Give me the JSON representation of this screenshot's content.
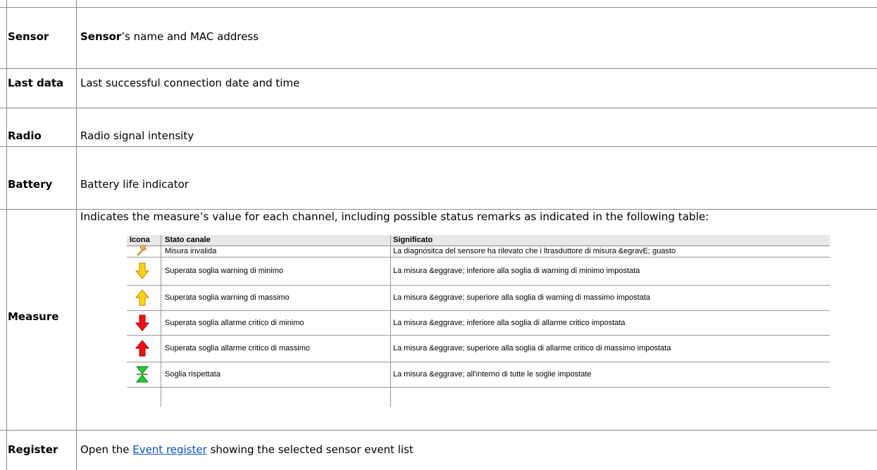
{
  "rows": [
    {
      "label": "Sensor",
      "desc_bold": "Sensor",
      "desc_rest": "’s name and MAC address"
    },
    {
      "label": "Last data",
      "desc": "Last successful connection date and time"
    },
    {
      "label": "Radio",
      "desc": "Radio signal intensity"
    },
    {
      "label": "Battery",
      "desc": "Battery life indicator"
    },
    {
      "label": "Measure",
      "desc": "Indicates the measure’s value for each channel, including possible status remarks as indicated in the following table:"
    },
    {
      "label": "Register",
      "desc_pre": "Open the ",
      "link": "Event register",
      "desc_post": " showing the selected sensor event list"
    }
  ],
  "status_table": {
    "headers": [
      "Icona",
      "Stato canale",
      "Significato"
    ],
    "rows": [
      {
        "icon": "wrench-icon",
        "state": "Misura invalida",
        "meaning": "La diagnositca del sensore ha rilevato che i ltrasduttore di misura &egravE; guasto"
      },
      {
        "icon": "arrow-down-yellow-icon",
        "state": "Superata soglia warning di minimo",
        "meaning": "La misura &eggrave; inferiore alla soglia di warning di minimo impostata"
      },
      {
        "icon": "arrow-up-yellow-icon",
        "state": "Superata soglia warning di massimo",
        "meaning": "La misura &eggrave; superiore alla soglia di warning di massimo impostata"
      },
      {
        "icon": "arrow-down-red-icon",
        "state": "Superata soglia allarme critico di minimo",
        "meaning": "La misura &eggrave; inferiore alla soglia di allarme critico impostata"
      },
      {
        "icon": "arrow-up-red-icon",
        "state": "Superata soglia allarme critico di massimo",
        "meaning": "La misura &eggrave; superiore alla soglia di allarme critico di massimo impostata"
      },
      {
        "icon": "threshold-ok-green-icon",
        "state": "Soglia rispettata",
        "meaning": "La misura &eggrave; all'interno di tutte le soglie impostate"
      }
    ]
  }
}
